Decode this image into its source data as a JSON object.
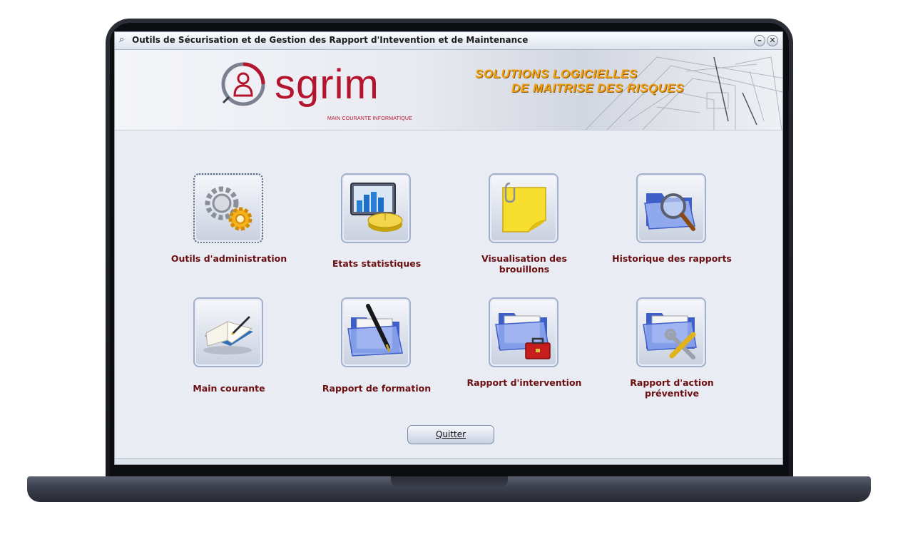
{
  "window": {
    "title": "Outils de Sécurisation et de Gestion des Rapport d'Intevention et de Maintenance",
    "minimize_glyph": "–",
    "close_glyph": "✕"
  },
  "banner": {
    "logo_text": "sgrim",
    "logo_subtitle": "MAIN COURANTE INFORMATIQUE",
    "slogan_line1": "SOLUTIONS LOGICIELLES",
    "slogan_line2": "DE MAITRISE DES RISQUES"
  },
  "tiles": [
    {
      "label": "Outils d'administration",
      "icon": "gears-icon"
    },
    {
      "label": "Etats statistiques",
      "icon": "statistics-icon"
    },
    {
      "label": "Visualisation des brouillons",
      "icon": "sticky-note-icon"
    },
    {
      "label": "Historique des rapports",
      "icon": "folder-search-icon"
    },
    {
      "label": "Main courante",
      "icon": "open-book-icon"
    },
    {
      "label": "Rapport de formation",
      "icon": "folder-pen-icon"
    },
    {
      "label": "Rapport d'intervention",
      "icon": "folder-toolbox-icon"
    },
    {
      "label": "Rapport d'action préventive",
      "icon": "folder-tools-icon"
    }
  ],
  "quit_button": {
    "label": "Quitter"
  },
  "colors": {
    "accent": "#b4152e",
    "label": "#6b0f12",
    "slogan": "#f2a012"
  }
}
